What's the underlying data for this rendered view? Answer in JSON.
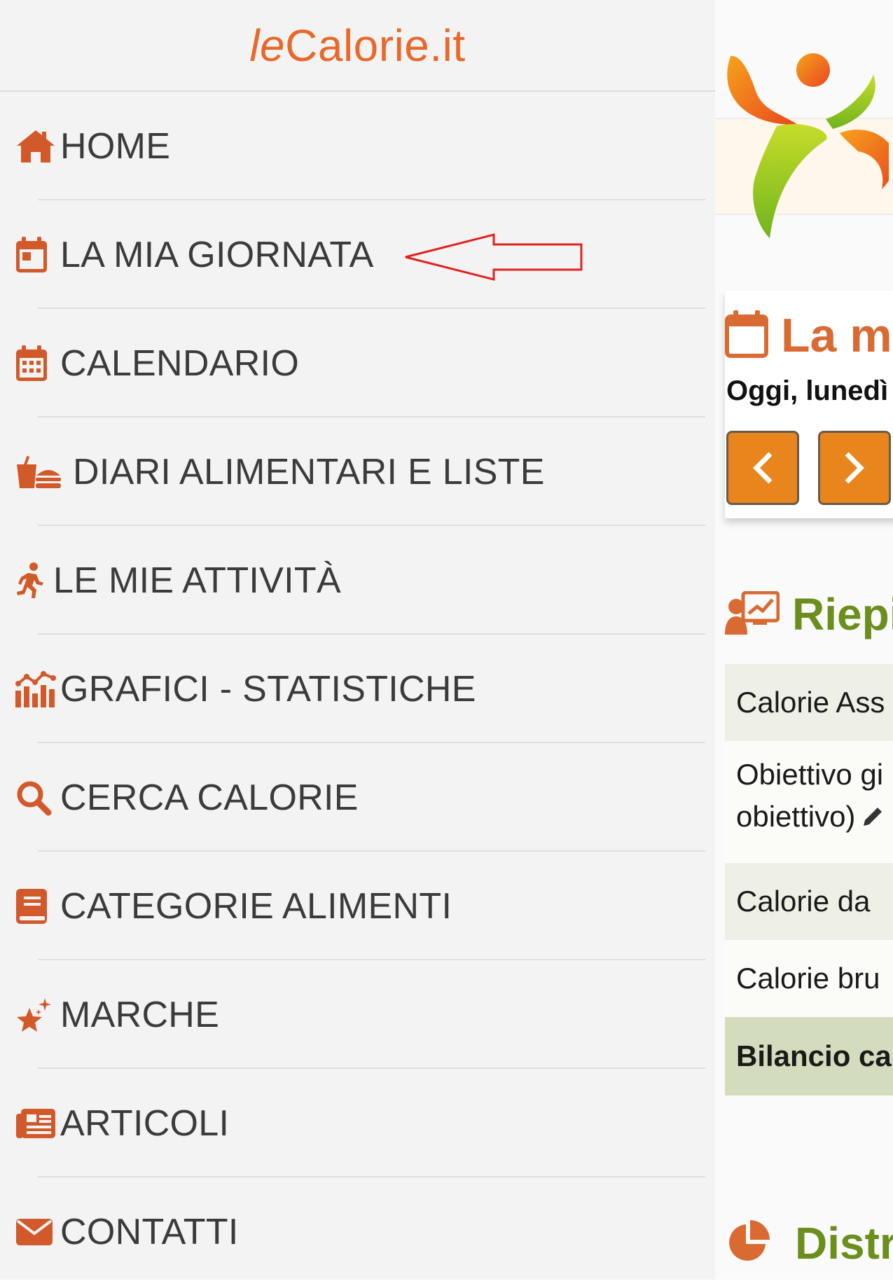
{
  "brand": {
    "prefix": "le",
    "name": "Calorie.it"
  },
  "menu": {
    "items": [
      {
        "label": "HOME",
        "icon": "home-icon"
      },
      {
        "label": "LA MIA GIORNATA",
        "icon": "calendar-day-icon"
      },
      {
        "label": "CALENDARIO",
        "icon": "calendar-icon"
      },
      {
        "label": "DIARI ALIMENTARI E LISTE",
        "icon": "food-icon"
      },
      {
        "label": "LE MIE ATTIVITÀ",
        "icon": "running-icon"
      },
      {
        "label": "GRAFICI - STATISTICHE",
        "icon": "chart-icon"
      },
      {
        "label": "CERCA CALORIE",
        "icon": "search-icon"
      },
      {
        "label": "CATEGORIE ALIMENTI",
        "icon": "book-icon"
      },
      {
        "label": "MARCHE",
        "icon": "star-icon"
      },
      {
        "label": "ARTICOLI",
        "icon": "newspaper-icon"
      },
      {
        "label": "CONTATTI",
        "icon": "envelope-icon"
      }
    ]
  },
  "main": {
    "page_title": "La m",
    "date_line": "Oggi, lunedì",
    "summary_title": "Riepi",
    "summary_rows": [
      {
        "text": "Calorie Ass"
      },
      {
        "line1": "Obiettivo gi",
        "line2": "obiettivo)"
      },
      {
        "text": "Calorie da"
      },
      {
        "text": "Calorie bru"
      },
      {
        "text": "Bilancio ca"
      }
    ],
    "distribution_title": "Distr"
  },
  "colors": {
    "brand_orange": "#e8692a",
    "icon_orange": "#d2592a",
    "button_orange": "#e8861d",
    "section_green": "#6a8f1c",
    "annotation_red": "#e0231f"
  }
}
